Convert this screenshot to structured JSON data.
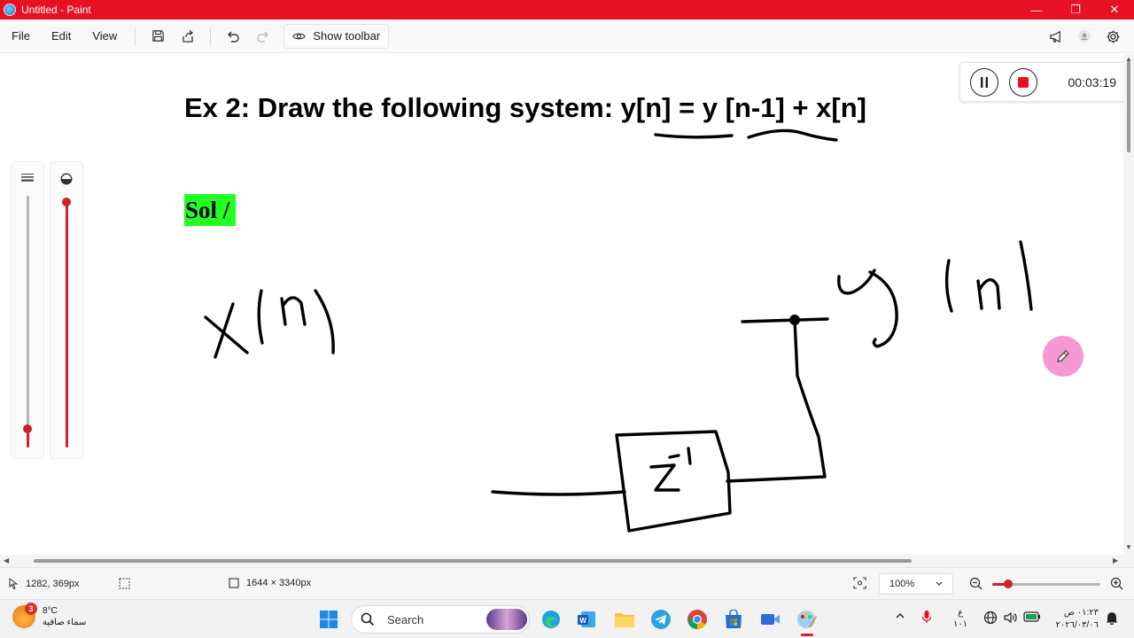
{
  "window": {
    "title": "Untitled - Paint",
    "minimize": "—",
    "maximize": "❐",
    "close": "✕"
  },
  "menu": {
    "file": "File",
    "edit": "Edit",
    "view": "View",
    "show_toolbar": "Show toolbar"
  },
  "canvas": {
    "title": "Ex 2: Draw the following system: y[n] = y [n-1] + x[n]",
    "sol_label": "Sol /",
    "highlight_color": "#22ff22"
  },
  "recorder": {
    "time": "00:03:19"
  },
  "status": {
    "cursor_position": "1282, 369px",
    "canvas_size": "1644 × 3340px",
    "zoom": "100%"
  },
  "taskbar": {
    "weather_temp": "8°C",
    "weather_desc": "سماء صافية",
    "weather_badge": "3",
    "search_label": "Search",
    "lang_line1": "ع",
    "lang_line2": "١٠١",
    "clock_time": "٠١:٢٣ ص",
    "clock_date": "٢٠٢٦/٠٣/٠٦"
  },
  "colors": {
    "titlebar": "#e81123",
    "accent": "#d21f2a"
  }
}
